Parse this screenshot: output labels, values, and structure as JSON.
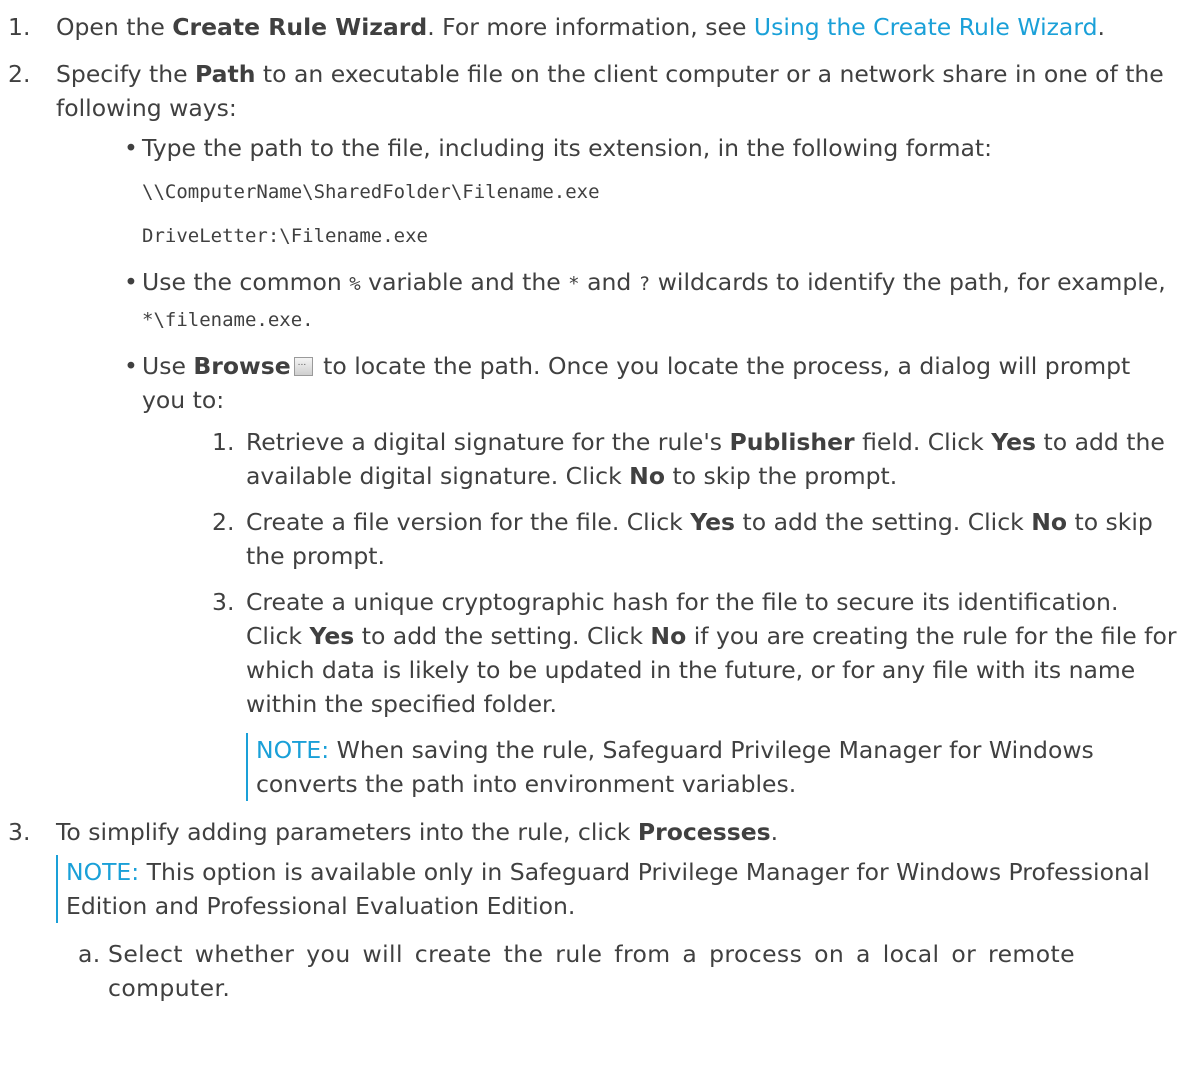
{
  "step1": {
    "num": "1.",
    "t1": "Open the ",
    "b1": "Create Rule Wizard",
    "t2": ". For more information, see ",
    "link": "Using the Create Rule Wizard",
    "t3": "."
  },
  "step2": {
    "num": "2.",
    "t1": "Specify the ",
    "b1": "Path",
    "t2": " to an executable file on the client computer or a network share in one of the following ways:",
    "bullet1": {
      "text": "Type the path to the file, including its extension, in the following format:",
      "code1": "\\\\ComputerName\\SharedFolder\\Filename.exe",
      "code2": "DriveLetter:\\Filename.exe"
    },
    "bullet2": {
      "t1": "Use the common ",
      "c1": "%",
      "t2": " variable and the ",
      "c2": "*",
      "t3": " and ",
      "c3": "?",
      "t4": " wildcards to identify the path, for example, ",
      "c4": "*\\filename.exe."
    },
    "bullet3": {
      "t1": "Use ",
      "b1": "Browse",
      "t2": " to locate the path. Once you locate the process, a dialog will prompt you to:",
      "sub": [
        {
          "num": "1.",
          "t1": "Retrieve a digital signature for the rule's ",
          "b1": "Publisher",
          "t2": " field. Click ",
          "b2": "Yes",
          "t3": " to add the available digital signature. Click ",
          "b3": "No",
          "t4": " to skip the prompt."
        },
        {
          "num": "2.",
          "t1": "Create a file version for the file. Click ",
          "b1": "Yes",
          "t2": " to add the setting. Click ",
          "b2": "No",
          "t3": " to skip the prompt."
        },
        {
          "num": "3.",
          "t1": "Create a unique cryptographic hash for the file to secure its identification. Click ",
          "b1": "Yes",
          "t2": " to add the setting. Click ",
          "b2": "No",
          "t3": " if you are creating the rule for the file for which data is likely to be updated in the future, or for any file with its name within the specified folder."
        }
      ]
    },
    "note": {
      "label": "NOTE:",
      "text": " When saving the rule, Safeguard Privilege Manager for Windows converts the path into environment variables."
    }
  },
  "step3": {
    "num": "3.",
    "t1": "To simplify adding parameters into the rule, click ",
    "b1": "Processes",
    "t2": ".",
    "note": {
      "label": "NOTE:",
      "text": " This option is available only in Safeguard Privilege Manager for Windows Professional Edition and Professional Evaluation Edition."
    },
    "sub_a": {
      "num": "a.",
      "text": "Select whether you will create the rule from a process on a local or remote computer."
    }
  }
}
